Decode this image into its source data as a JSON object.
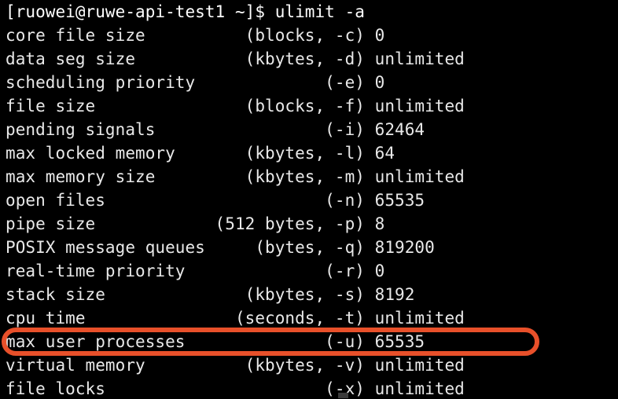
{
  "terminal": {
    "prompt": "[ruowei@ruwe-api-test1 ~]$ ulimit -a",
    "user": "ruowei",
    "host": "ruwe-api-test1",
    "cwd": "~",
    "command": "ulimit -a",
    "background_color": "#000000",
    "foreground_color": "#e9e9e9",
    "lines": [
      "[ruowei@ruwe-api-test1 ~]$ ulimit -a",
      "core file size          (blocks, -c) 0",
      "data seg size           (kbytes, -d) unlimited",
      "scheduling priority             (-e) 0",
      "file size               (blocks, -f) unlimited",
      "pending signals                 (-i) 62464",
      "max locked memory       (kbytes, -l) 64",
      "max memory size         (kbytes, -m) unlimited",
      "open files                      (-n) 65535",
      "pipe size            (512 bytes, -p) 8",
      "POSIX message queues     (bytes, -q) 819200",
      "real-time priority              (-r) 0",
      "stack size              (kbytes, -s) 8192",
      "cpu time               (seconds, -t) unlimited",
      "max user processes              (-u) 65535",
      "virtual memory          (kbytes, -v) unlimited",
      "file locks                      (-x) unlimited"
    ],
    "limits": [
      {
        "name": "core file size",
        "unit": "blocks",
        "flag": "-c",
        "value": "0"
      },
      {
        "name": "data seg size",
        "unit": "kbytes",
        "flag": "-d",
        "value": "unlimited"
      },
      {
        "name": "scheduling priority",
        "unit": "",
        "flag": "-e",
        "value": "0"
      },
      {
        "name": "file size",
        "unit": "blocks",
        "flag": "-f",
        "value": "unlimited"
      },
      {
        "name": "pending signals",
        "unit": "",
        "flag": "-i",
        "value": "62464"
      },
      {
        "name": "max locked memory",
        "unit": "kbytes",
        "flag": "-l",
        "value": "64"
      },
      {
        "name": "max memory size",
        "unit": "kbytes",
        "flag": "-m",
        "value": "unlimited"
      },
      {
        "name": "open files",
        "unit": "",
        "flag": "-n",
        "value": "65535"
      },
      {
        "name": "pipe size",
        "unit": "512 bytes",
        "flag": "-p",
        "value": "8"
      },
      {
        "name": "POSIX message queues",
        "unit": "bytes",
        "flag": "-q",
        "value": "819200"
      },
      {
        "name": "real-time priority",
        "unit": "",
        "flag": "-r",
        "value": "0"
      },
      {
        "name": "stack size",
        "unit": "kbytes",
        "flag": "-s",
        "value": "8192"
      },
      {
        "name": "cpu time",
        "unit": "seconds",
        "flag": "-t",
        "value": "unlimited"
      },
      {
        "name": "max user processes",
        "unit": "",
        "flag": "-u",
        "value": "65535"
      },
      {
        "name": "virtual memory",
        "unit": "kbytes",
        "flag": "-v",
        "value": "unlimited"
      },
      {
        "name": "file locks",
        "unit": "",
        "flag": "-x",
        "value": "unlimited"
      }
    ]
  },
  "annotation": {
    "type": "rounded-rectangle-highlight",
    "target_line_index": 14,
    "target_text": "max user processes              (-u) 65535",
    "color": "#e8502a",
    "stroke_width": 6
  },
  "cursor": {
    "visible": true,
    "style": "block"
  }
}
